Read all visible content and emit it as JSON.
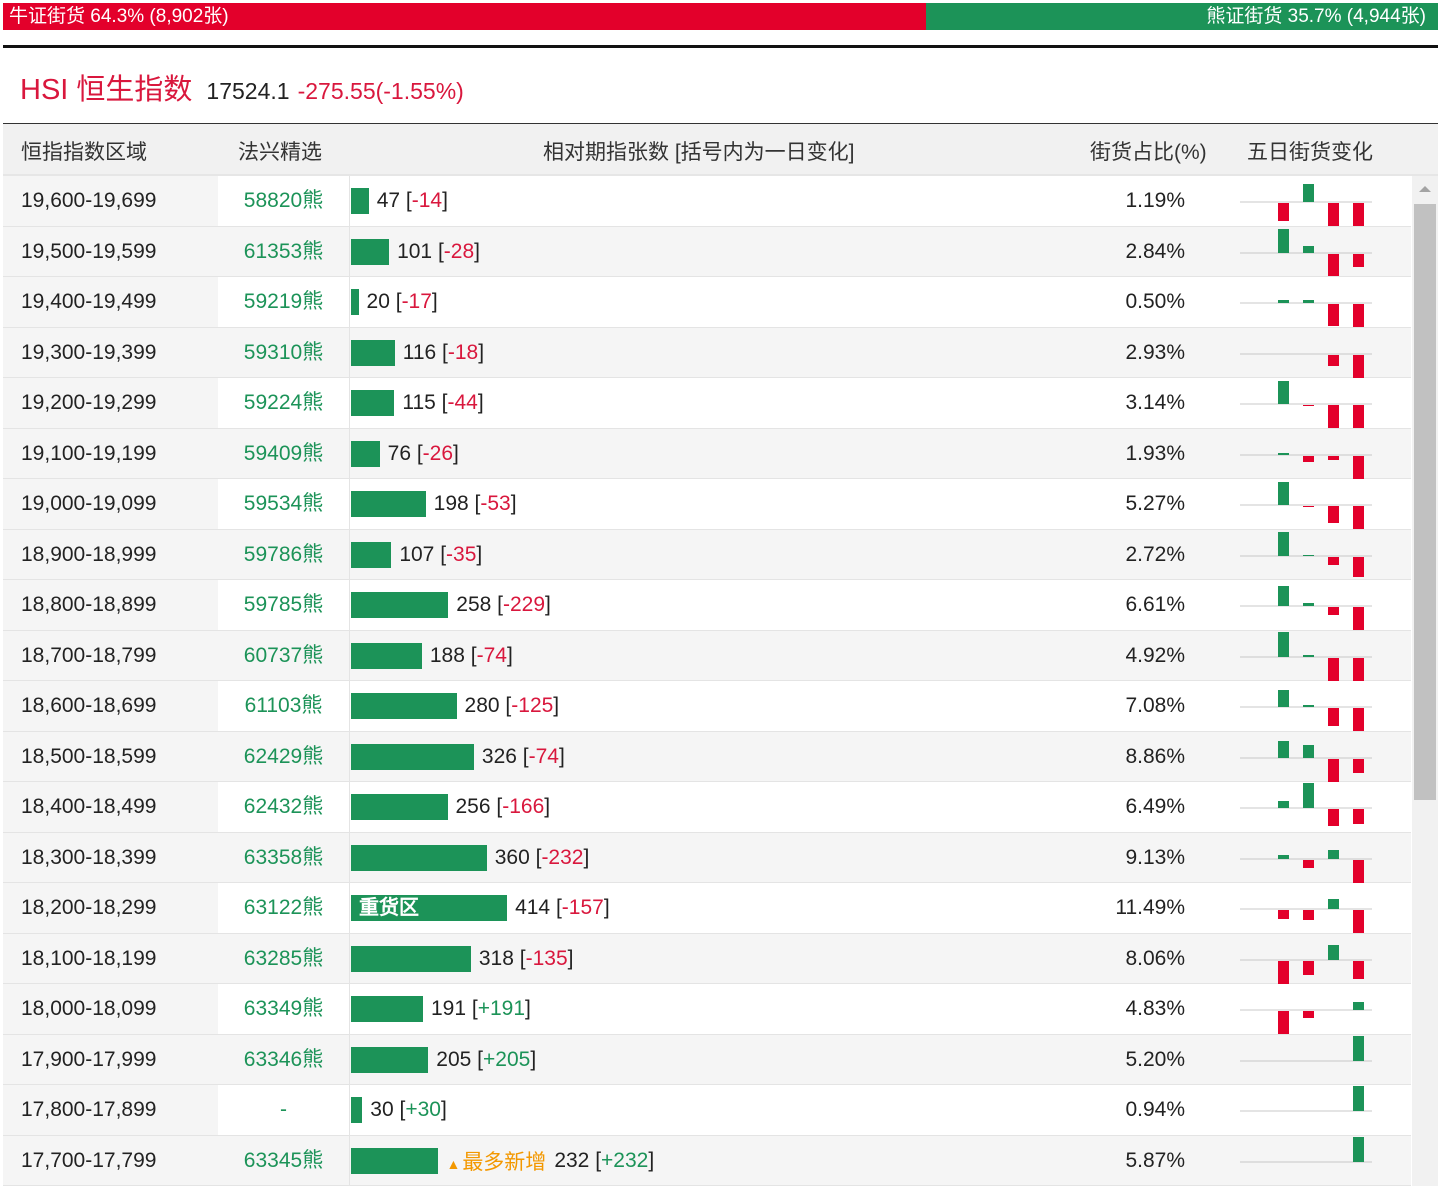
{
  "summary": {
    "bull_label": "牛证街货 64.3% (8,902张)",
    "bear_label": "熊证街货 35.7% (4,944张)",
    "bull_pct": 64.3,
    "bear_pct": 35.7
  },
  "index": {
    "name": "HSI 恒生指数",
    "price": "17524.1",
    "change": "-275.55(-1.55%)"
  },
  "headers": {
    "range": "恒指指数区域",
    "pick": "法兴精选",
    "count": "相对期指张数 [括号内为一日变化]",
    "ratio": "街货占比(%)",
    "trend": "五日街货变化"
  },
  "colors": {
    "bull": "#e3002b",
    "bear": "#1c9358",
    "tag": "#f39800"
  },
  "rows": [
    {
      "range": "19,600-19,699",
      "pick": "58820熊",
      "count": 47,
      "count_text": "47",
      "delta": "-14",
      "ratio": "1.19%",
      "trend": [
        -18,
        18,
        -25,
        -25
      ]
    },
    {
      "range": "19,500-19,599",
      "pick": "61353熊",
      "count": 101,
      "count_text": "101",
      "delta": "-28",
      "ratio": "2.84%",
      "trend": [
        24,
        7,
        -22,
        -13
      ]
    },
    {
      "range": "19,400-19,499",
      "pick": "59219熊",
      "count": 20,
      "count_text": "20",
      "delta": "-17",
      "ratio": "0.50%",
      "trend": [
        3,
        3,
        -22,
        -25
      ]
    },
    {
      "range": "19,300-19,399",
      "pick": "59310熊",
      "count": 116,
      "count_text": "116",
      "delta": "-18",
      "ratio": "2.93%",
      "trend": [
        0,
        0,
        -11,
        -25
      ]
    },
    {
      "range": "19,200-19,299",
      "pick": "59224熊",
      "count": 115,
      "count_text": "115",
      "delta": "-44",
      "ratio": "3.14%",
      "trend": [
        23,
        -1,
        -23,
        -25
      ]
    },
    {
      "range": "19,100-19,199",
      "pick": "59409熊",
      "count": 76,
      "count_text": "76",
      "delta": "-26",
      "ratio": "1.93%",
      "trend": [
        2,
        -6,
        -4,
        -25
      ]
    },
    {
      "range": "19,000-19,099",
      "pick": "59534熊",
      "count": 198,
      "count_text": "198",
      "delta": "-53",
      "ratio": "5.27%",
      "trend": [
        23,
        -1,
        -17,
        -25
      ]
    },
    {
      "range": "18,900-18,999",
      "pick": "59786熊",
      "count": 107,
      "count_text": "107",
      "delta": "-35",
      "ratio": "2.72%",
      "trend": [
        24,
        1,
        -8,
        -20
      ]
    },
    {
      "range": "18,800-18,899",
      "pick": "59785熊",
      "count": 258,
      "count_text": "258",
      "delta": "-229",
      "ratio": "6.61%",
      "trend": [
        20,
        3,
        -8,
        -24
      ]
    },
    {
      "range": "18,700-18,799",
      "pick": "60737熊",
      "count": 188,
      "count_text": "188",
      "delta": "-74",
      "ratio": "4.92%",
      "trend": [
        25,
        2,
        -24,
        -23
      ]
    },
    {
      "range": "18,600-18,699",
      "pick": "61103熊",
      "count": 280,
      "count_text": "280",
      "delta": "-125",
      "ratio": "7.08%",
      "trend": [
        17,
        2,
        -18,
        -24
      ]
    },
    {
      "range": "18,500-18,599",
      "pick": "62429熊",
      "count": 326,
      "count_text": "326",
      "delta": "-74",
      "ratio": "8.86%",
      "trend": [
        17,
        13,
        -25,
        -14
      ]
    },
    {
      "range": "18,400-18,499",
      "pick": "62432熊",
      "count": 256,
      "count_text": "256",
      "delta": "-166",
      "ratio": "6.49%",
      "trend": [
        7,
        25,
        -17,
        -15
      ]
    },
    {
      "range": "18,300-18,399",
      "pick": "63358熊",
      "count": 360,
      "count_text": "360",
      "delta": "-232",
      "ratio": "9.13%",
      "trend": [
        4,
        -8,
        9,
        -25
      ]
    },
    {
      "range": "18,200-18,299",
      "pick": "63122熊",
      "count": 414,
      "count_text": "414",
      "delta": "-157",
      "ratio": "11.49%",
      "bar_label": "重货区",
      "trend": [
        -9,
        -10,
        10,
        -24
      ]
    },
    {
      "range": "18,100-18,199",
      "pick": "63285熊",
      "count": 318,
      "count_text": "318",
      "delta": "-135",
      "ratio": "8.06%",
      "trend": [
        -25,
        -14,
        15,
        -18
      ]
    },
    {
      "range": "18,000-18,099",
      "pick": "63349熊",
      "count": 191,
      "count_text": "191",
      "delta": "+191",
      "ratio": "4.83%",
      "trend": [
        -24,
        -7,
        0,
        8
      ]
    },
    {
      "range": "17,900-17,999",
      "pick": "63346熊",
      "count": 205,
      "count_text": "205",
      "delta": "+205",
      "ratio": "5.20%",
      "trend": [
        0,
        0,
        0,
        25
      ]
    },
    {
      "range": "17,800-17,899",
      "pick": "-",
      "count": 30,
      "count_text": "30",
      "delta": "+30",
      "ratio": "0.94%",
      "trend": [
        0,
        0,
        0,
        25
      ]
    },
    {
      "range": "17,700-17,799",
      "pick": "63345熊",
      "count": 232,
      "count_text": "232",
      "delta": "+232",
      "ratio": "5.87%",
      "tag": "最多新增",
      "trend": [
        0,
        0,
        0,
        25
      ]
    }
  ]
}
